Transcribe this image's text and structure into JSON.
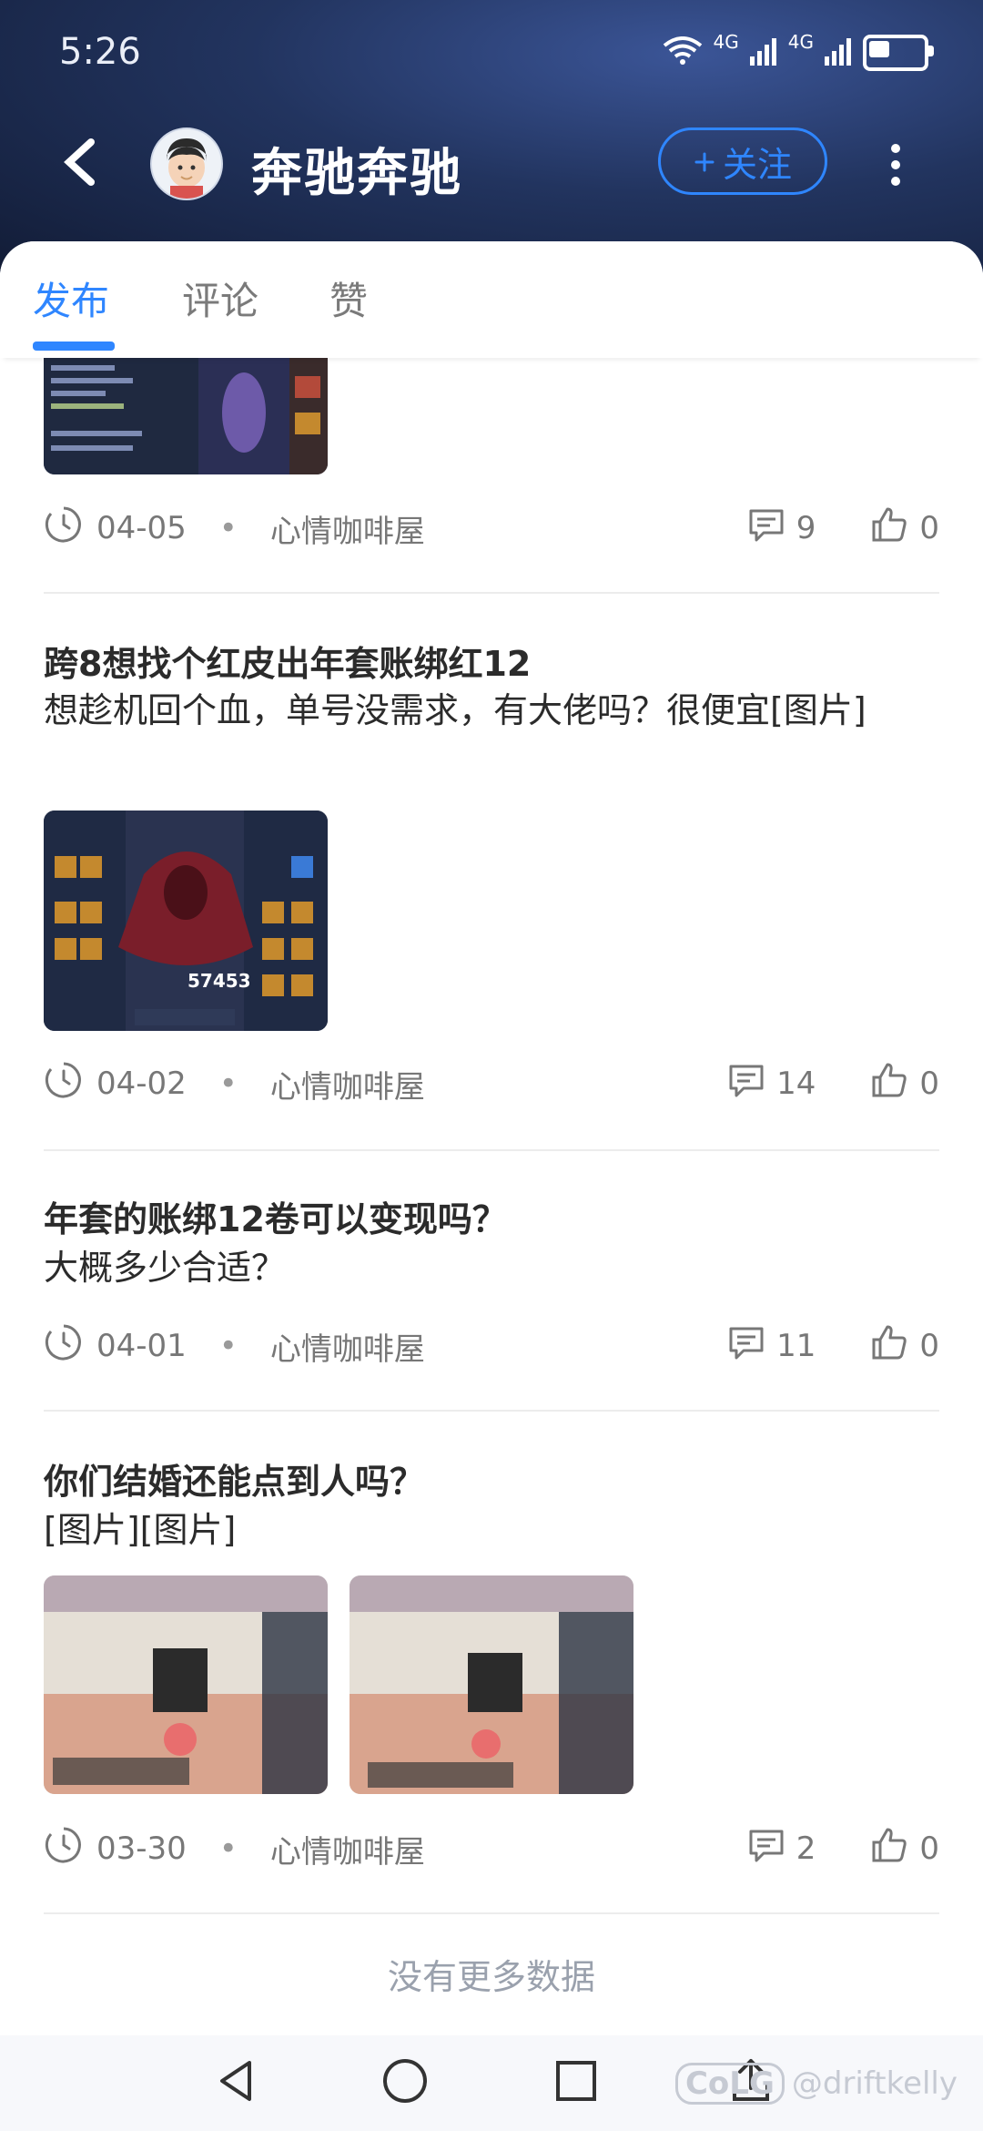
{
  "status_bar": {
    "time": "5:26",
    "network_1": "4G",
    "network_2": "4G"
  },
  "header": {
    "title": "奔驰奔驰",
    "follow_label": "关注"
  },
  "tabs": [
    {
      "label": "发布"
    },
    {
      "label": "评论"
    },
    {
      "label": "赞"
    }
  ],
  "posts": [
    {
      "date": "04-05",
      "board": "心情咖啡屋",
      "comments": "9",
      "likes": "0"
    },
    {
      "title": "跨8想找个红皮出年套账绑红12",
      "body": "想趁机回个血，单号没需求，有大佬吗？很便宜[图片]",
      "date": "04-02",
      "board": "心情咖啡屋",
      "comments": "14",
      "likes": "0",
      "image_caption": "57453"
    },
    {
      "title": "年套的账绑12卷可以变现吗？",
      "body": "大概多少合适？",
      "date": "04-01",
      "board": "心情咖啡屋",
      "comments": "11",
      "likes": "0"
    },
    {
      "title": "你们结婚还能点到人吗？",
      "body": "[图片][图片]",
      "date": "03-30",
      "board": "心情咖啡屋",
      "comments": "2",
      "likes": "0"
    }
  ],
  "footer": {
    "no_more": "没有更多数据"
  },
  "watermark": {
    "logo": "CoLG",
    "handle": "@driftkelly"
  },
  "colors": {
    "accent": "#2f86ff",
    "header_bg": "#1b2a4f"
  }
}
